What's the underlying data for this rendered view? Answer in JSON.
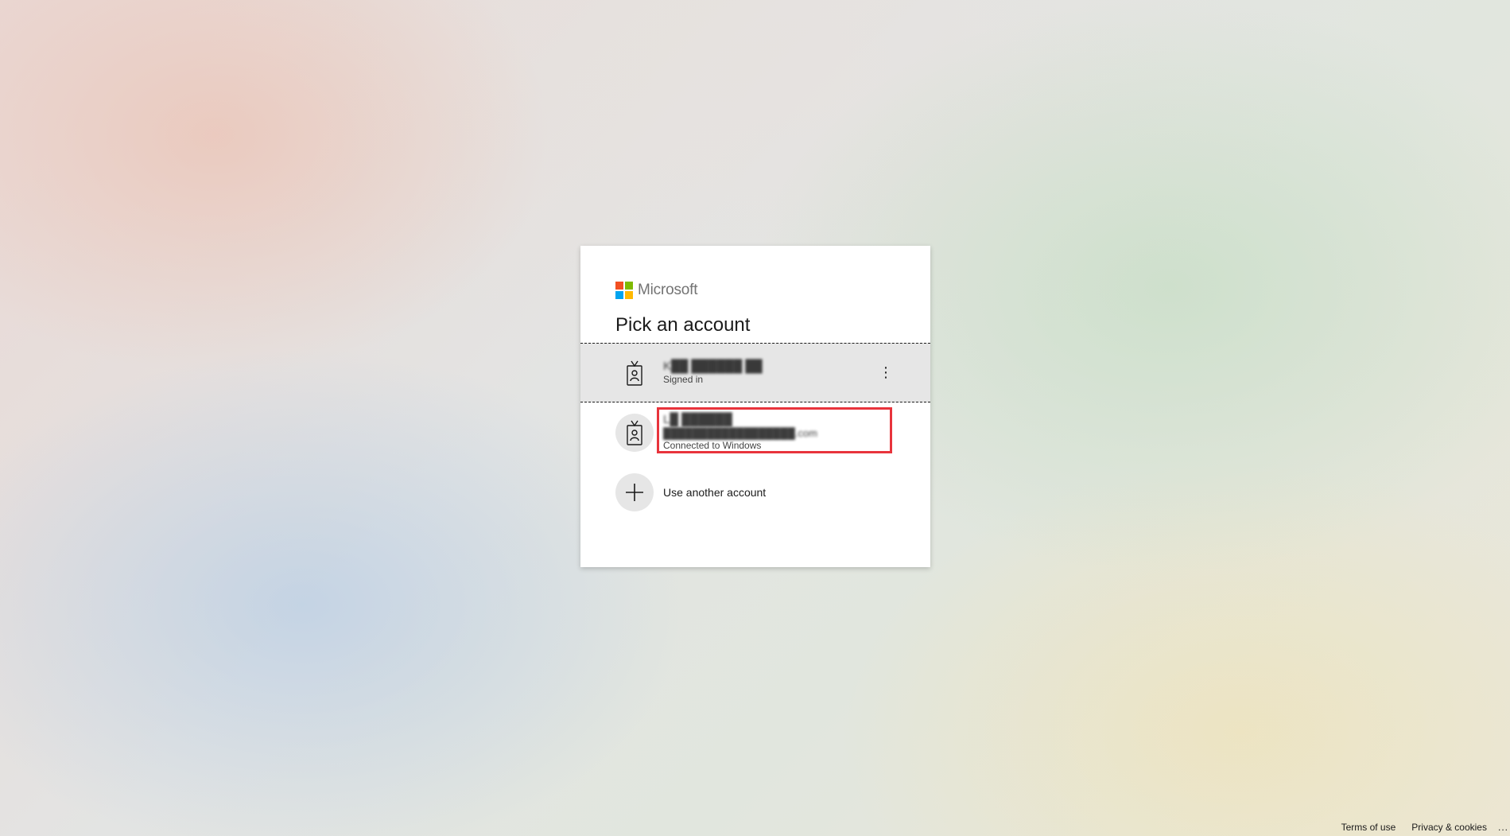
{
  "brand": {
    "name": "Microsoft",
    "logo_colors": [
      "#f25022",
      "#7fba00",
      "#00a4ef",
      "#ffb900"
    ]
  },
  "title": "Pick an account",
  "accounts": [
    {
      "name": "K██ ██████ ██",
      "status": "Signed in",
      "more_label": "⋮",
      "icon": "badge-person-icon"
    },
    {
      "name": "L█ ██████",
      "email": "██████████████████.com",
      "status": "Connected to Windows",
      "icon": "badge-person-icon"
    }
  ],
  "use_another": {
    "label": "Use another account",
    "icon": "plus-icon"
  },
  "footer": {
    "terms": "Terms of use",
    "privacy": "Privacy & cookies",
    "more": "..."
  },
  "highlight_color": "#e8343c"
}
